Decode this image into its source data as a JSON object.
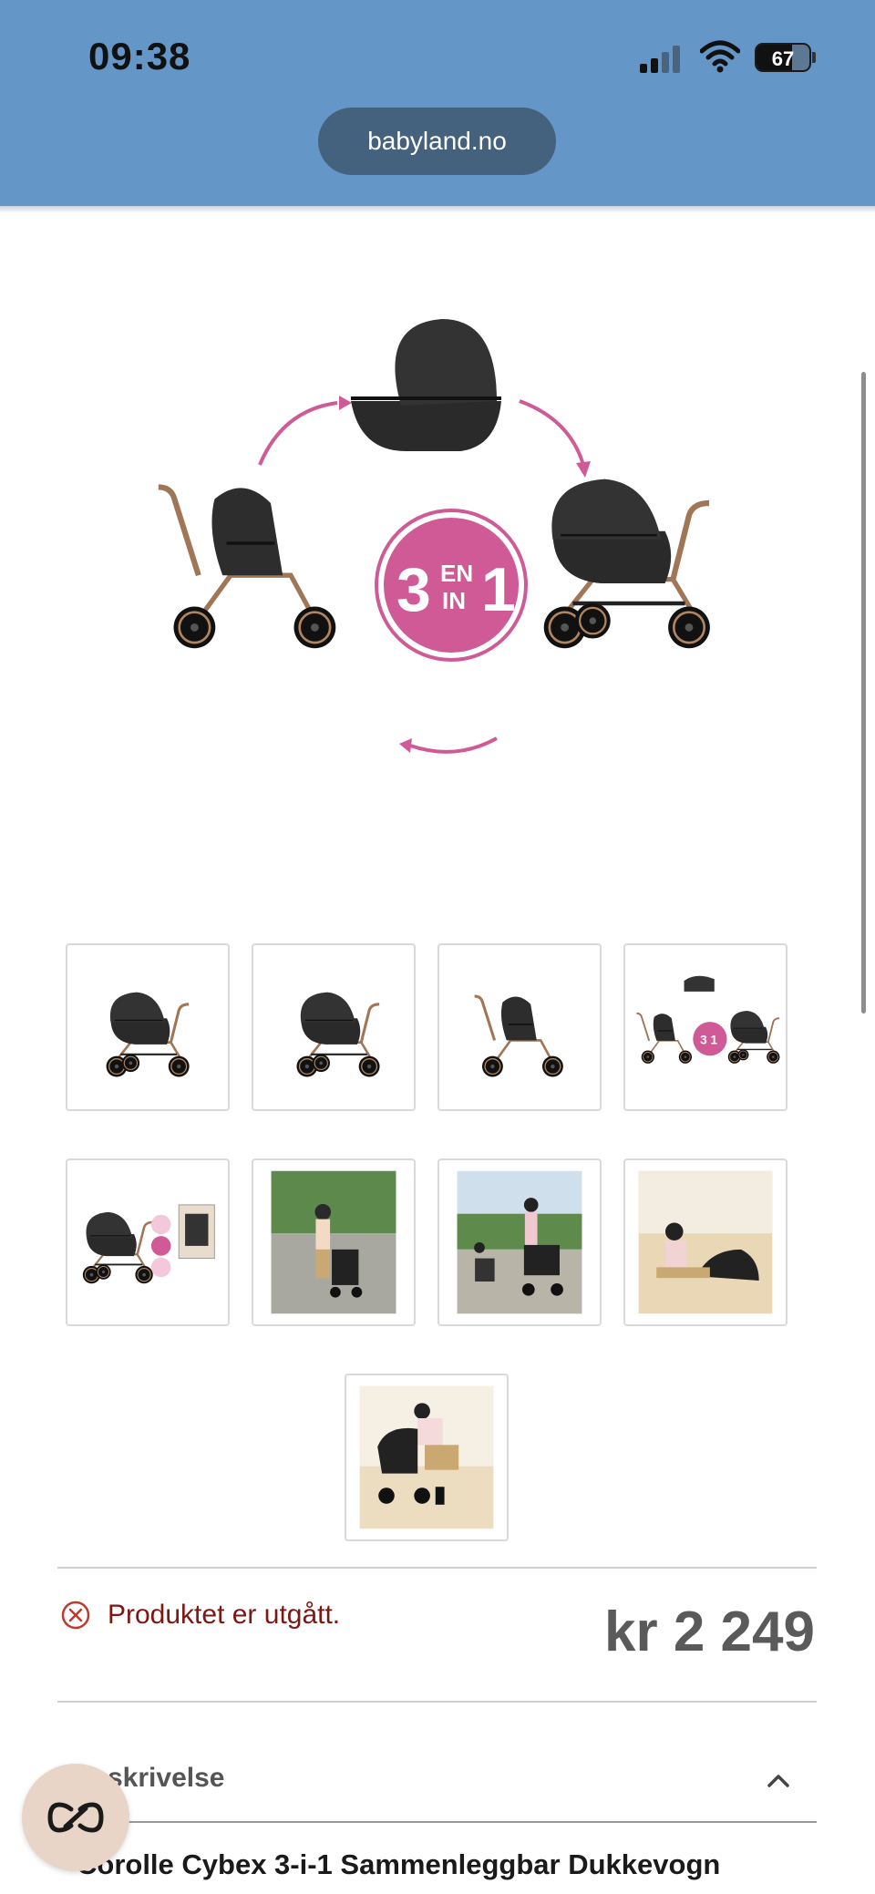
{
  "status_bar": {
    "time": "09:38",
    "battery": "67"
  },
  "browser": {
    "url": "babyland.no"
  },
  "hero": {
    "badge_number_left": "3",
    "badge_en": "EN",
    "badge_in": "IN",
    "badge_number_right": "1"
  },
  "thumbnails": {
    "count": 9,
    "badge_small": "3 EN IN 1"
  },
  "availability": {
    "status": "Produktet er utgått.",
    "price": "kr 2 249"
  },
  "description": {
    "header": "skrivelse",
    "product_title": "Corolle Cybex 3-i-1 Sammenleggbar Dukkevogn"
  },
  "colors": {
    "header_bg": "#6497c8",
    "url_pill_bg": "#44617d",
    "accent_pink": "#cf5a96",
    "error_red": "#c0392b",
    "error_text": "#7d1713",
    "price_grey": "#5a5a5a"
  }
}
